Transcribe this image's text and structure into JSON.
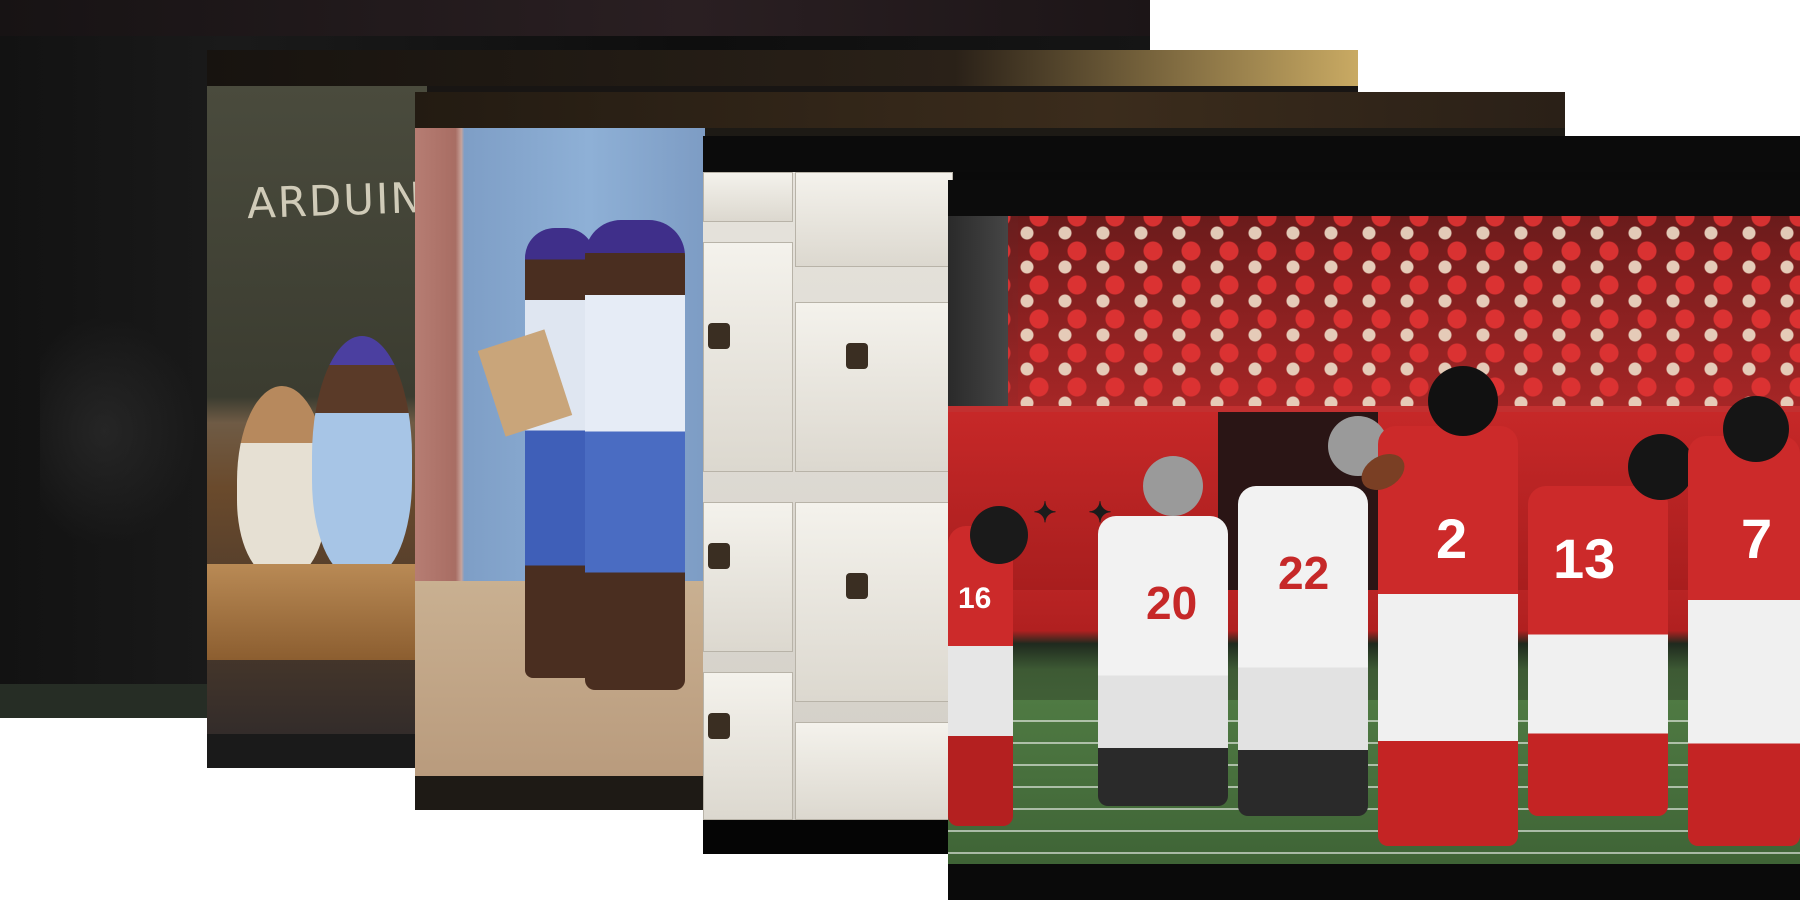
{
  "stack": {
    "cards": [
      {
        "id": "card-1",
        "subject": "dark-frame"
      },
      {
        "id": "card-2",
        "subject": "classroom"
      },
      {
        "id": "card-3",
        "subject": "schoolgirls"
      },
      {
        "id": "card-4",
        "subject": "archive-boxes"
      },
      {
        "id": "card-5",
        "subject": "football-game"
      }
    ]
  },
  "card2": {
    "chalkboard_text": "ARDUIN"
  },
  "card5": {
    "jersey_numbers": [
      "2",
      "13",
      "7",
      "16",
      "20",
      "22"
    ]
  },
  "colors": {
    "falcons_red": "#c62828",
    "buccaneers_white": "#f2f2f2",
    "letterbox": "#0a0a0a"
  }
}
